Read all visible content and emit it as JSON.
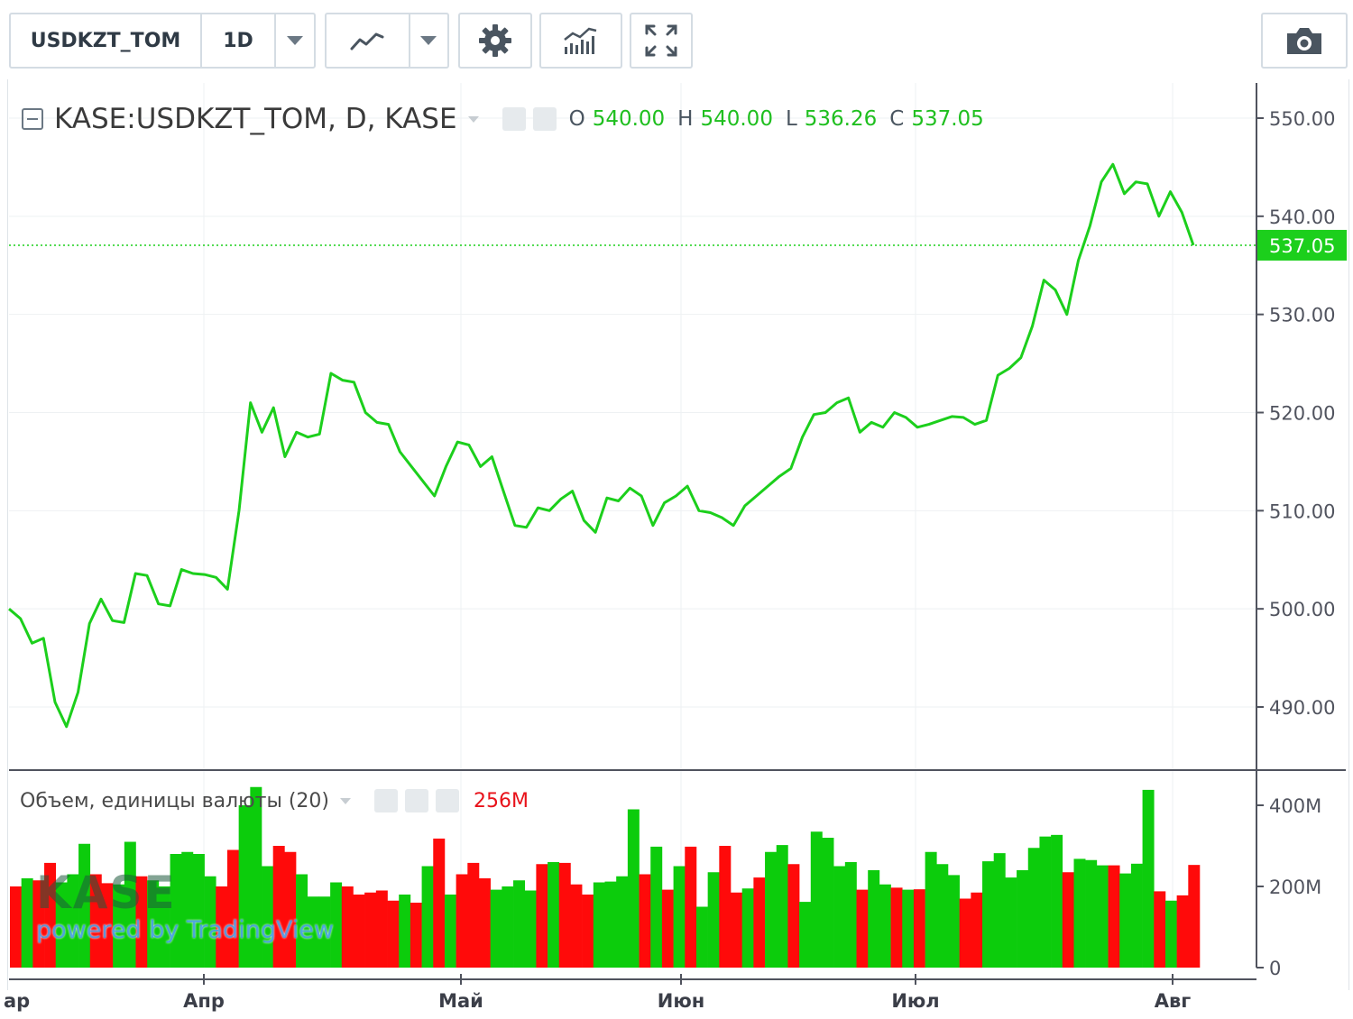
{
  "toolbar": {
    "symbol": "USDKZT_TOM",
    "interval": "1D",
    "icons": [
      "chevron-down-icon",
      "line-chart-icon",
      "chevron-down-icon",
      "gear-icon",
      "indicators-icon",
      "fullscreen-icon",
      "camera-icon"
    ]
  },
  "legend": {
    "title": "KASE:USDKZT_TOM, D, KASE",
    "o_label": "O",
    "o_value": "540.00",
    "h_label": "H",
    "h_value": "540.00",
    "l_label": "L",
    "l_value": "536.26",
    "c_label": "C",
    "c_value": "537.05"
  },
  "volume_legend": {
    "title": "Объем, единицы валюты (20)",
    "value": "256M"
  },
  "watermark": {
    "logo": "KASE",
    "powered": "powered by TradingView"
  },
  "colors": {
    "line": "#1ccf1c",
    "up_volume": "#0ccc0c",
    "down_volume": "#ff0a0a",
    "last_price_badge": "#1ccf1c",
    "axis_text": "#50535e",
    "grid": "#eef1f3"
  },
  "chart_data": [
    {
      "type": "line",
      "title": "KASE:USDKZT_TOM, D, KASE",
      "x_ticks": [
        "ap",
        "Апр",
        "Май",
        "Июн",
        "Июл",
        "Авг"
      ],
      "y_ticks": [
        "490.00",
        "500.00",
        "510.00",
        "520.00",
        "530.00",
        "540.00",
        "550.00"
      ],
      "ylim": [
        484,
        553
      ],
      "last_price": 537.05,
      "last_price_label": "537.05",
      "series": [
        {
          "values": [
            500.0,
            499.0,
            496.5,
            497.0,
            490.5,
            488.0,
            491.5,
            498.5,
            501.0,
            498.8,
            498.6,
            503.6,
            503.4,
            500.5,
            500.3,
            504.0,
            503.6,
            503.5,
            503.2,
            502.0,
            510.0,
            521.0,
            518.0,
            520.5,
            515.5,
            518.0,
            517.5,
            517.8,
            524.0,
            523.3,
            523.1,
            520.0,
            519.0,
            518.8,
            516.0,
            514.5,
            513.0,
            511.5,
            514.5,
            517.0,
            516.7,
            514.5,
            515.5,
            512.0,
            508.5,
            508.3,
            510.3,
            510.0,
            511.2,
            512.0,
            509.0,
            507.8,
            511.3,
            511.0,
            512.3,
            511.5,
            508.5,
            510.8,
            511.5,
            512.5,
            510.0,
            509.8,
            509.3,
            508.5,
            510.5,
            511.5,
            512.5,
            513.5,
            514.3,
            517.5,
            519.8,
            520.0,
            521.0,
            521.5,
            518.0,
            519.0,
            518.5,
            520.0,
            519.5,
            518.5,
            518.8,
            519.2,
            519.6,
            519.5,
            518.8,
            519.2,
            523.8,
            524.5,
            525.6,
            528.8,
            533.5,
            532.5,
            530.0,
            535.5,
            539.0,
            543.5,
            545.3,
            542.3,
            543.5,
            543.3,
            540.0,
            542.5,
            540.4,
            537.05
          ]
        }
      ]
    },
    {
      "type": "bar",
      "title": "Объем, единицы валюты (20)",
      "y_ticks": [
        "0",
        "200M",
        "400M"
      ],
      "ylim": [
        0,
        455
      ],
      "value_label": "256M",
      "values": [
        200,
        220,
        215,
        258,
        210,
        230,
        305,
        230,
        208,
        205,
        310,
        225,
        215,
        200,
        280,
        285,
        280,
        225,
        200,
        290,
        400,
        445,
        250,
        300,
        285,
        230,
        175,
        175,
        210,
        200,
        180,
        185,
        190,
        165,
        180,
        160,
        250,
        318,
        180,
        230,
        258,
        220,
        192,
        200,
        215,
        190,
        255,
        260,
        258,
        205,
        180,
        210,
        212,
        225,
        390,
        230,
        298,
        192,
        250,
        298,
        150,
        235,
        300,
        185,
        195,
        222,
        285,
        302,
        255,
        162,
        335,
        320,
        250,
        260,
        192,
        240,
        205,
        197,
        192,
        193,
        285,
        255,
        228,
        170,
        185,
        262,
        282,
        222,
        240,
        295,
        323,
        327,
        235,
        268,
        265,
        252,
        252,
        232,
        256,
        438,
        188,
        165,
        178,
        253
      ],
      "up": [
        false,
        true,
        false,
        false,
        true,
        true,
        true,
        false,
        false,
        true,
        true,
        false,
        true,
        true,
        true,
        true,
        true,
        true,
        false,
        false,
        true,
        true,
        true,
        false,
        false,
        true,
        true,
        true,
        true,
        false,
        false,
        false,
        false,
        false,
        true,
        false,
        true,
        false,
        true,
        false,
        false,
        false,
        true,
        true,
        true,
        true,
        false,
        true,
        false,
        false,
        false,
        true,
        true,
        true,
        true,
        false,
        true,
        false,
        true,
        false,
        true,
        true,
        false,
        false,
        true,
        false,
        true,
        true,
        false,
        true,
        true,
        true,
        true,
        true,
        false,
        true,
        true,
        false,
        true,
        false,
        true,
        true,
        true,
        false,
        false,
        true,
        true,
        true,
        true,
        true,
        true,
        true,
        false,
        true,
        true,
        true,
        false,
        true,
        true,
        true,
        false,
        true,
        false,
        false
      ]
    }
  ]
}
